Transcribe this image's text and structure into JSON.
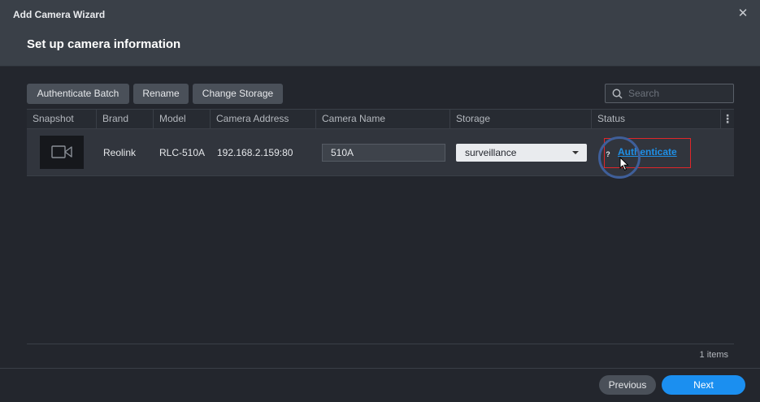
{
  "window": {
    "title": "Add Camera Wizard",
    "close_icon": "close-icon"
  },
  "step": {
    "title": "Set up camera information"
  },
  "toolbar": {
    "authenticate_batch": "Authenticate Batch",
    "rename": "Rename",
    "change_storage": "Change Storage"
  },
  "search": {
    "placeholder": "Search",
    "value": ""
  },
  "table": {
    "columns": [
      "Snapshot",
      "Brand",
      "Model",
      "Camera Address",
      "Camera Name",
      "Storage",
      "Status"
    ],
    "rows": [
      {
        "snapshot_icon": "camera-icon",
        "brand": "Reolink",
        "model": "RLC-510A",
        "address": "192.168.2.159:80",
        "camera_name": "510A",
        "storage": "surveillance",
        "status_mark": "?",
        "status_link": "Authenticate"
      }
    ],
    "item_count": "1 items"
  },
  "footer": {
    "previous": "Previous",
    "next": "Next"
  },
  "colors": {
    "accent": "#1b8ff0",
    "highlight_box": "#e0262a",
    "link": "#1f8fe5"
  }
}
